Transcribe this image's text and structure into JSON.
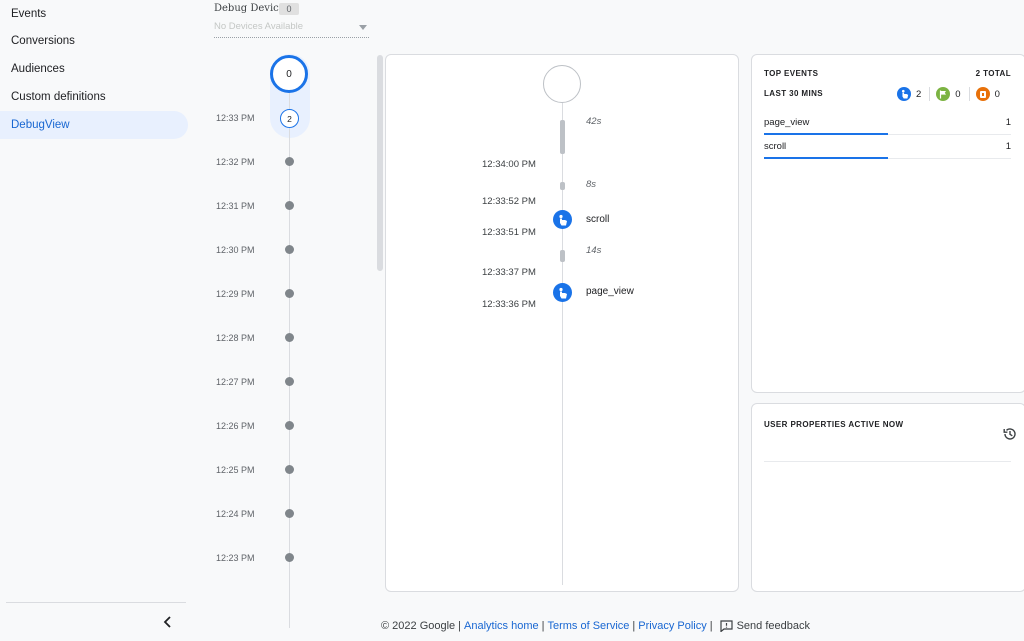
{
  "sidebar": {
    "items": [
      {
        "label": "Events"
      },
      {
        "label": "Conversions"
      },
      {
        "label": "Audiences"
      },
      {
        "label": "Custom definitions"
      },
      {
        "label": "DebugView",
        "active": true
      }
    ],
    "collapse_icon": "chevron-left-icon"
  },
  "device": {
    "label": "Debug Device",
    "count": "0",
    "placeholder": "No Devices Available"
  },
  "minutes": {
    "current_count": "0",
    "selected_count": "2",
    "labels": [
      "12:33 PM",
      "12:32 PM",
      "12:31 PM",
      "12:30 PM",
      "12:29 PM",
      "12:28 PM",
      "12:27 PM",
      "12:26 PM",
      "12:25 PM",
      "12:24 PM",
      "12:23 PM"
    ]
  },
  "seconds": {
    "gaps": [
      "42s",
      "8s",
      "14s"
    ],
    "times": [
      "12:34:00 PM",
      "12:33:52 PM",
      "12:33:51 PM",
      "12:33:37 PM",
      "12:33:36 PM"
    ],
    "events": [
      {
        "name": "scroll",
        "icon": "touch-icon"
      },
      {
        "name": "page_view",
        "icon": "touch-icon"
      }
    ]
  },
  "top_events": {
    "title": "TOP EVENTS",
    "total": "2 TOTAL",
    "range": "LAST 30 MINS",
    "counts": [
      {
        "value": "2",
        "color": "#1a73e8",
        "icon": "touch-icon"
      },
      {
        "value": "0",
        "color": "#7cb342",
        "icon": "flag-icon"
      },
      {
        "value": "0",
        "color": "#e8710a",
        "icon": "user-icon"
      }
    ],
    "rows": [
      {
        "name": "page_view",
        "count": "1",
        "share": 0.5
      },
      {
        "name": "scroll",
        "count": "1",
        "share": 0.5
      }
    ]
  },
  "user_properties": {
    "title": "USER PROPERTIES ACTIVE NOW",
    "history_icon": "history-icon"
  },
  "footer": {
    "copyright": "© 2022 Google",
    "links": [
      "Analytics home",
      "Terms of Service",
      "Privacy Policy"
    ],
    "feedback": "Send feedback"
  },
  "colors": {
    "accent": "#1a73e8",
    "active_nav_bg": "#e8f0fe",
    "active_nav_text": "#1967d2"
  }
}
